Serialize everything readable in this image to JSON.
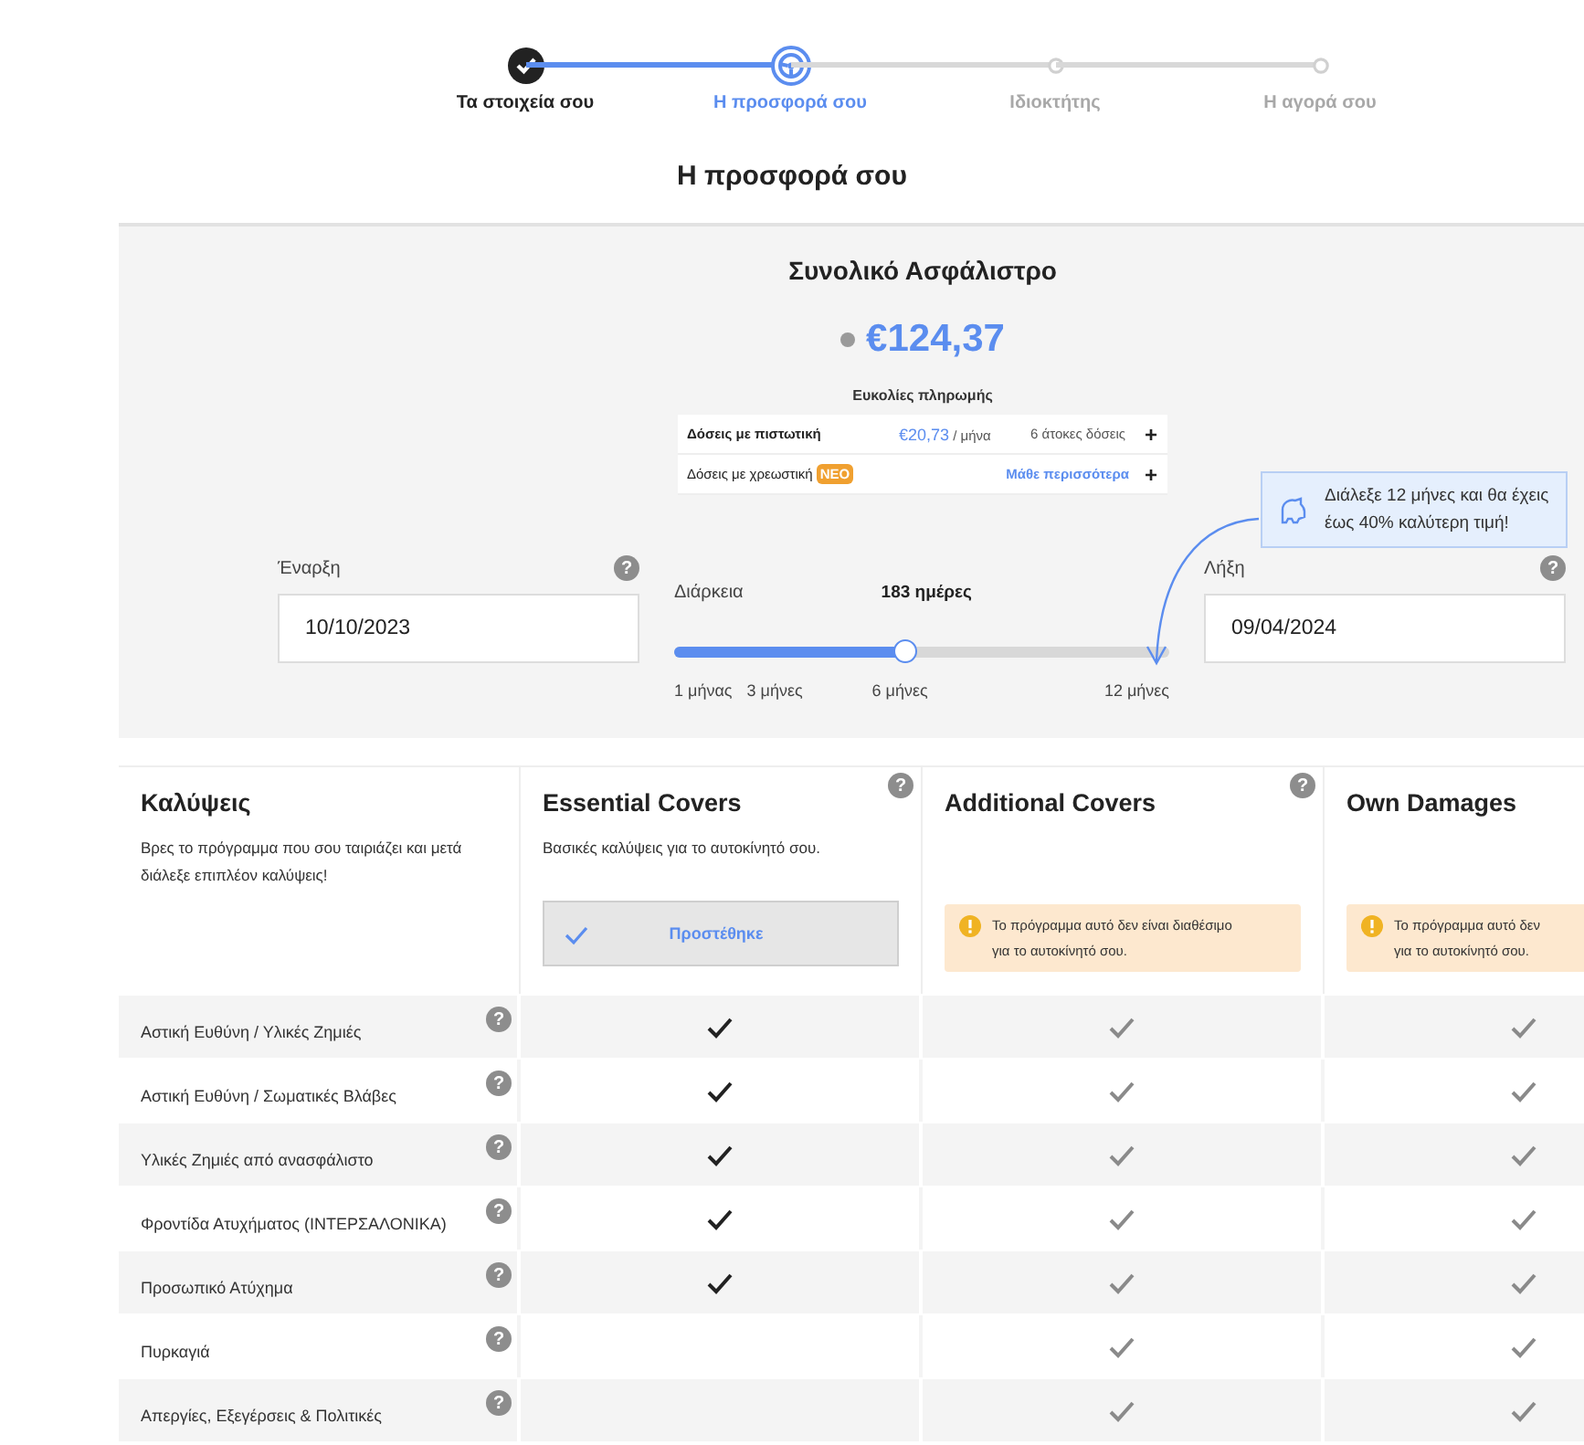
{
  "stepper": [
    {
      "label": "Τα στοιχεία σου",
      "completed": true,
      "selected": false
    },
    {
      "label": "Η προσφορά σου",
      "completed": false,
      "selected": true
    },
    {
      "label": "Ιδιοκτήτης",
      "completed": false,
      "selected": false
    },
    {
      "label": "Η αγορά σου",
      "completed": false,
      "selected": false
    }
  ],
  "page_title": "Η προσφορά σου",
  "premium": {
    "title": "Συνολικό Ασφάλιστρο",
    "amount": "€124,37"
  },
  "payments": {
    "title": "Ευκολίες πληρωμής",
    "rows": [
      {
        "kind": "price",
        "label": "Δόσεις με πιστωτική",
        "price": "€20,73",
        "unit": "/ μήνα",
        "note": "6 άτοκες δόσεις",
        "action": "+"
      },
      {
        "kind": "link",
        "label": "Δόσεις με χρεωστική",
        "badge": "ΝΕΟ",
        "link": "Μάθε περισσότερα",
        "action": "+"
      }
    ]
  },
  "start": {
    "label": "Έναρξη",
    "value": "10/10/2023",
    "help": "?"
  },
  "duration": {
    "label": "Διάρκεια",
    "value": "183 ημέρες",
    "level": 0.47,
    "ticks": [
      "1 μήνας",
      "3 μήνες",
      "6 μήνες",
      "12 μήνες"
    ]
  },
  "end": {
    "label": "Λήξη",
    "value": "09/04/2024",
    "help": "?"
  },
  "tip": "Διάλεξε 12 μήνες και θα έχεις έως 40% καλύτερη τιμή!",
  "covers": {
    "title": "Καλύψεις",
    "subtitle": "Βρες το πρόγραμμα που σου ταιριάζει και μετά διάλεξε επιπλέον καλύψεις!",
    "plans": [
      {
        "name": "Essential Covers",
        "help": "?",
        "description": "Βασικές καλύψεις για το αυτοκίνητό σου.",
        "kind": "added",
        "button": "Προστέθηκε"
      },
      {
        "name": "Additional Covers",
        "help": "?",
        "kind": "unavailable",
        "notice": "Το πρόγραμμα αυτό δεν είναι διαθέσιμο\nγια το αυτοκίνητό σου."
      },
      {
        "name": "Own Damages",
        "kind": "unavailable",
        "notice": "Το πρόγραμμα αυτό δεν\nγια το αυτοκίνητό σου."
      }
    ],
    "rows": [
      {
        "label": "Αστική Ευθύνη / Υλικές Ζημιές",
        "help": "?",
        "cells": [
          {
            "checked": true
          },
          {
            "checked": true
          },
          {
            "checked": true
          }
        ]
      },
      {
        "label": "Αστική Ευθύνη / Σωματικές Βλάβες",
        "help": "?",
        "cells": [
          {
            "checked": true
          },
          {
            "checked": true
          },
          {
            "checked": true
          }
        ]
      },
      {
        "label": "Υλικές Ζημιές από ανασφάλιστο",
        "help": "?",
        "cells": [
          {
            "checked": true
          },
          {
            "checked": true
          },
          {
            "checked": true
          }
        ]
      },
      {
        "label": "Φροντίδα Ατυχήματος (ΙΝΤΕΡΣΑΛΟΝΙΚΑ)",
        "help": "?",
        "cells": [
          {
            "checked": true
          },
          {
            "checked": true
          },
          {
            "checked": true
          }
        ]
      },
      {
        "label": "Προσωπικό Ατύχημα",
        "help": "?",
        "cells": [
          {
            "checked": true
          },
          {
            "checked": true
          },
          {
            "checked": true
          }
        ]
      },
      {
        "label": "Πυρκαγιά",
        "help": "?",
        "cells": [
          {
            "checked": false
          },
          {
            "checked": true
          },
          {
            "checked": true
          }
        ]
      },
      {
        "label": "Απεργίες, Εξεγέρσεις & Πολιτικές",
        "help": "?",
        "cells": [
          {
            "checked": false
          },
          {
            "checked": true
          },
          {
            "checked": true
          }
        ]
      }
    ]
  }
}
